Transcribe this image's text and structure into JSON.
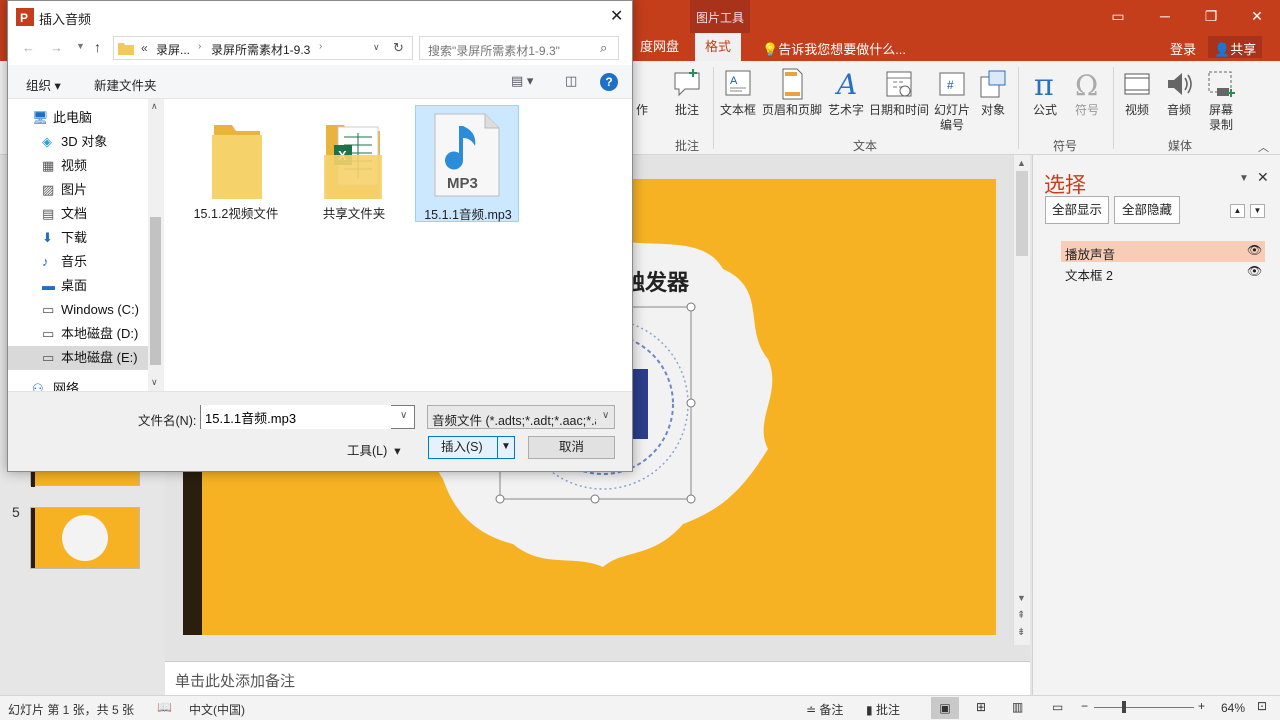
{
  "ppt": {
    "tabs": [
      "度网盘",
      "格式"
    ],
    "context_tools": "图片工具",
    "tell_me": "告诉我您想要做什么...",
    "login": "登录",
    "share": "共享",
    "ribbon": {
      "partial_left": "作",
      "comment": "批注",
      "textbox": "文本框",
      "header_footer": "页眉和页脚",
      "wordart": "艺术字",
      "datetime": "日期和时间",
      "slide_number_1": "幻灯片",
      "slide_number_2": "编号",
      "object": "对象",
      "equation": "公式",
      "symbol": "符号",
      "video": "视频",
      "audio": "音频",
      "screen_rec_1": "屏幕",
      "screen_rec_2": "录制",
      "group_comments": "批注",
      "group_text": "文本",
      "group_symbols": "符号",
      "group_media": "媒体"
    },
    "slide_number": "5",
    "slide_text": "触发器",
    "notes_placeholder": "单击此处添加备注",
    "selection_pane": {
      "title": "选择",
      "show_all": "全部显示",
      "hide_all": "全部隐藏",
      "items": [
        "播放声音",
        "文本框 2"
      ]
    },
    "status": {
      "slide_info": "幻灯片 第 1 张，共 5 张",
      "language": "中文(中国)",
      "notes": "备注",
      "comments": "批注",
      "zoom": "64%"
    }
  },
  "dialog": {
    "title": "插入音频",
    "breadcrumb": [
      "«",
      "录屏...",
      "录屏所需素材1-9.3"
    ],
    "search_placeholder": "搜索\"录屏所需素材1-9.3\"",
    "organize": "组织",
    "new_folder": "新建文件夹",
    "tree": [
      {
        "label": "此电脑",
        "icon": "computer-icon"
      },
      {
        "label": "3D 对象",
        "icon": "cube-icon"
      },
      {
        "label": "视频",
        "icon": "film-icon"
      },
      {
        "label": "图片",
        "icon": "picture-icon"
      },
      {
        "label": "文档",
        "icon": "document-icon"
      },
      {
        "label": "下载",
        "icon": "download-arrow-icon"
      },
      {
        "label": "音乐",
        "icon": "music-note-icon"
      },
      {
        "label": "桌面",
        "icon": "desktop-icon"
      },
      {
        "label": "Windows (C:)",
        "icon": "drive-icon"
      },
      {
        "label": "本地磁盘 (D:)",
        "icon": "drive-icon"
      },
      {
        "label": "本地磁盘 (E:)",
        "icon": "drive-icon"
      },
      {
        "label": "网络",
        "icon": "network-icon"
      }
    ],
    "files": [
      {
        "name": "15.1.2视频文件",
        "type": "folder"
      },
      {
        "name": "共享文件夹",
        "type": "folder-excel"
      },
      {
        "name": "15.1.1音频.mp3",
        "type": "mp3",
        "selected": true,
        "badge": "MP3"
      }
    ],
    "filename_label": "文件名(N):",
    "filename_value": "15.1.1音频.mp3",
    "filter_value": "音频文件 (*.adts;*.adt;*.aac;*.a",
    "tools": "工具(L)",
    "insert": "插入(S)",
    "cancel": "取消"
  }
}
